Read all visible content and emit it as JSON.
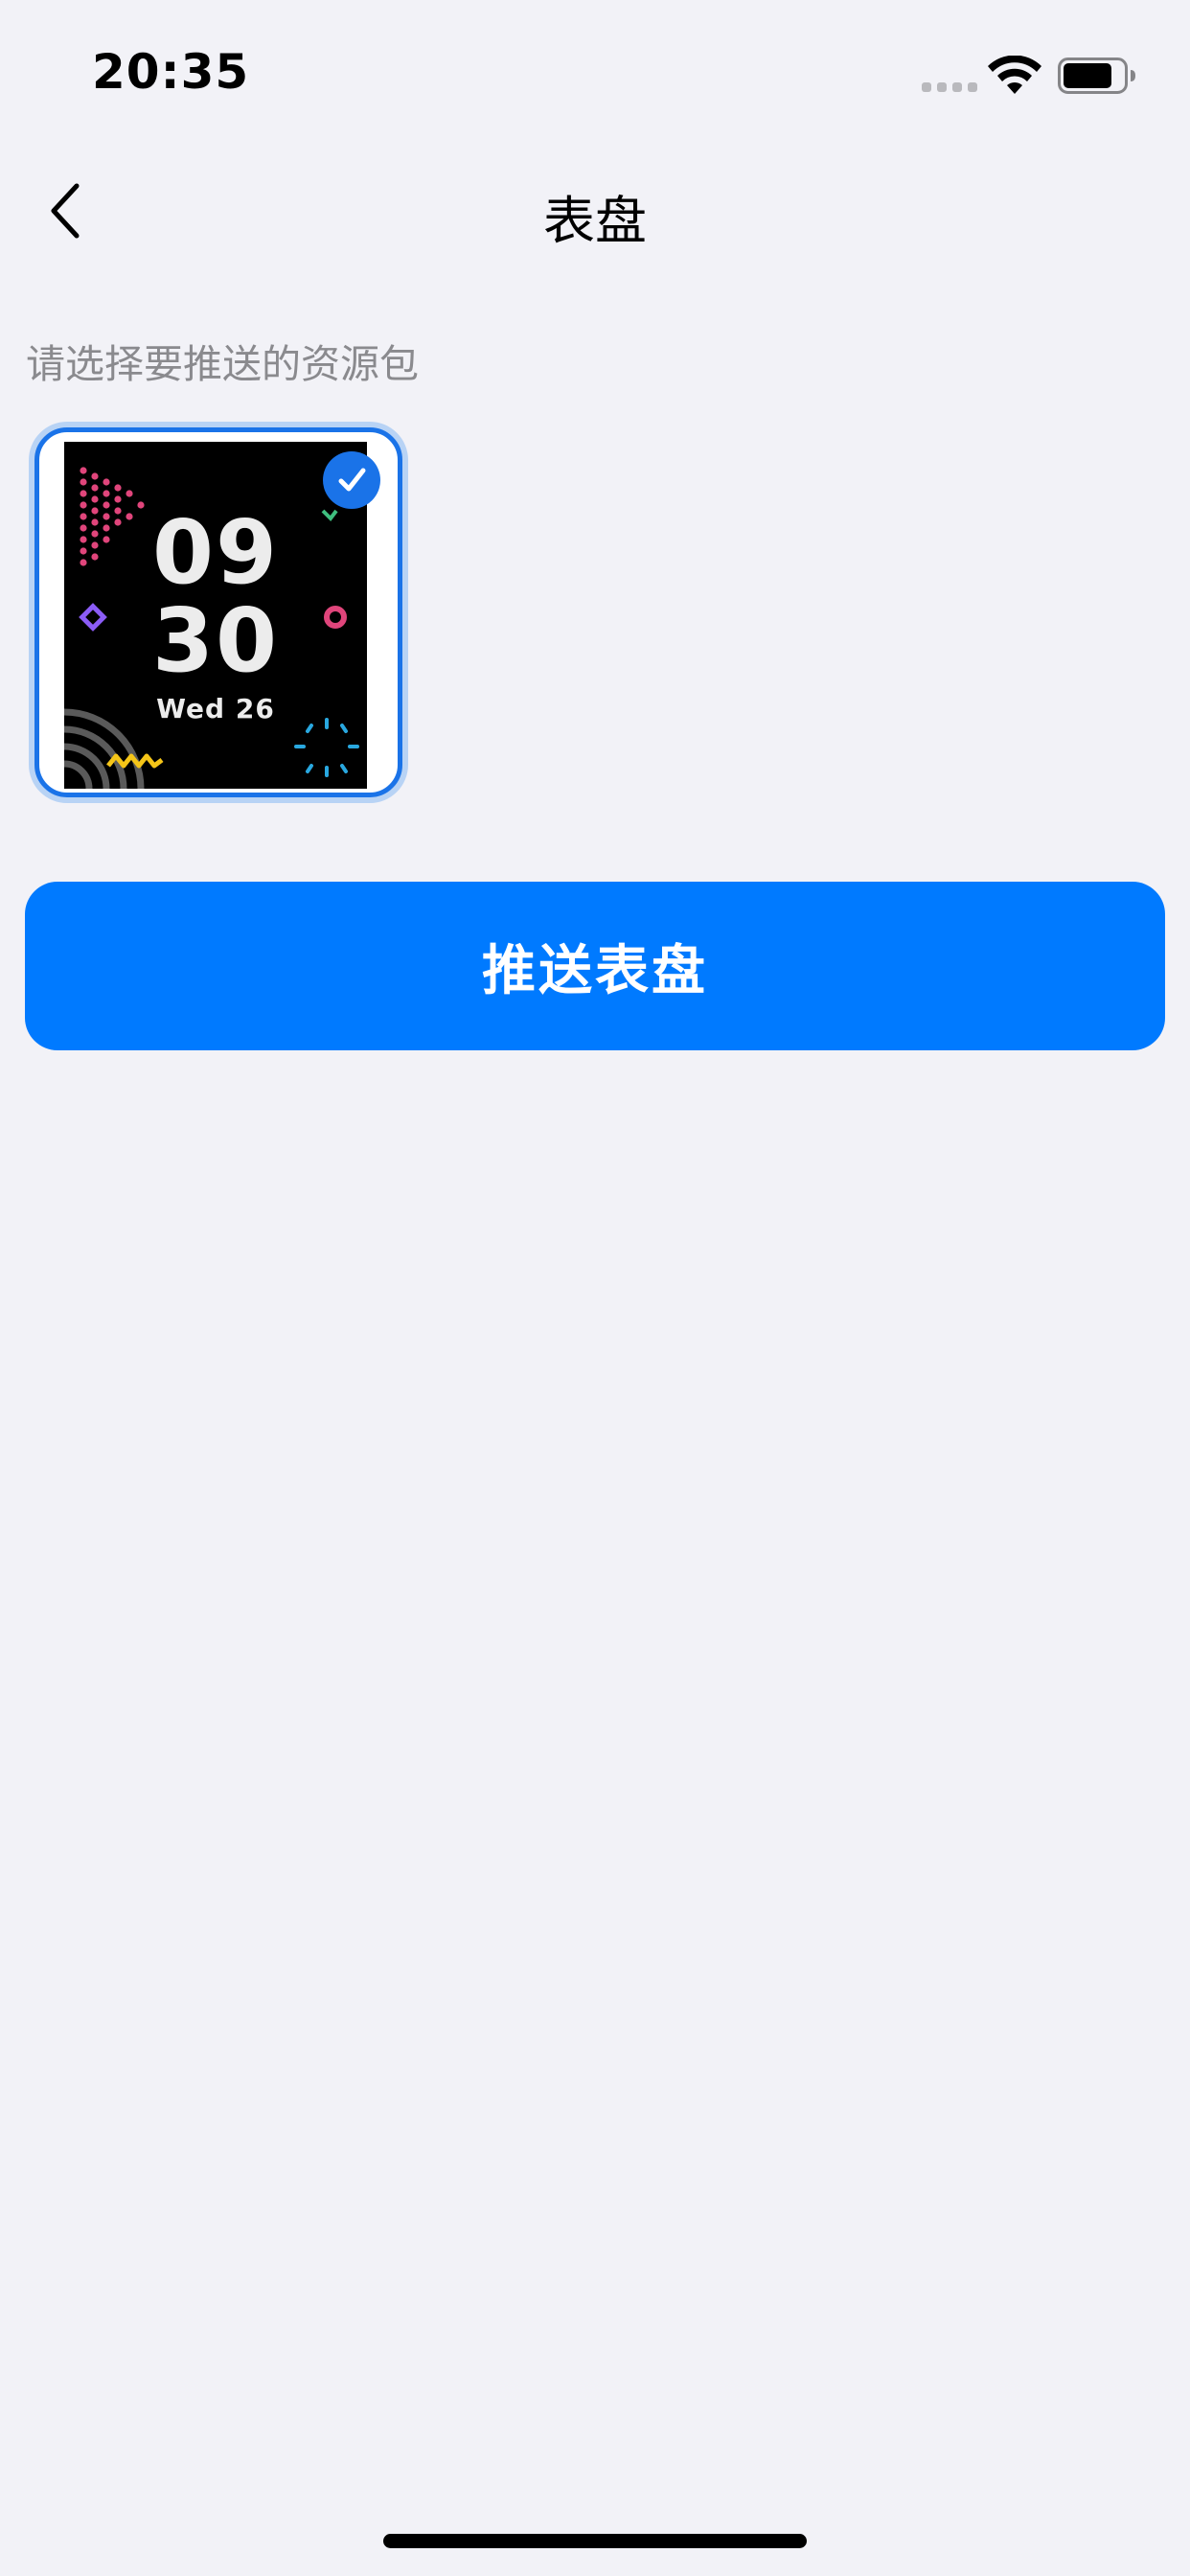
{
  "status_bar": {
    "time": "20:35",
    "icons": [
      "signal-icon",
      "wifi-icon",
      "battery-icon"
    ]
  },
  "nav": {
    "back_icon": "chevron-left-icon",
    "title": "表盘"
  },
  "hint": "请选择要推送的资源包",
  "watch_faces": [
    {
      "selected": true,
      "check_icon": "checkmark-icon",
      "preview": {
        "hour": "09",
        "minute": "30",
        "date": "Wed 26"
      }
    }
  ],
  "push_button_label": "推送表盘",
  "colors": {
    "accent": "#007aff",
    "selection_border": "#1a73e8",
    "background": "#f2f2f7",
    "hint_text": "#8a8a8e"
  }
}
